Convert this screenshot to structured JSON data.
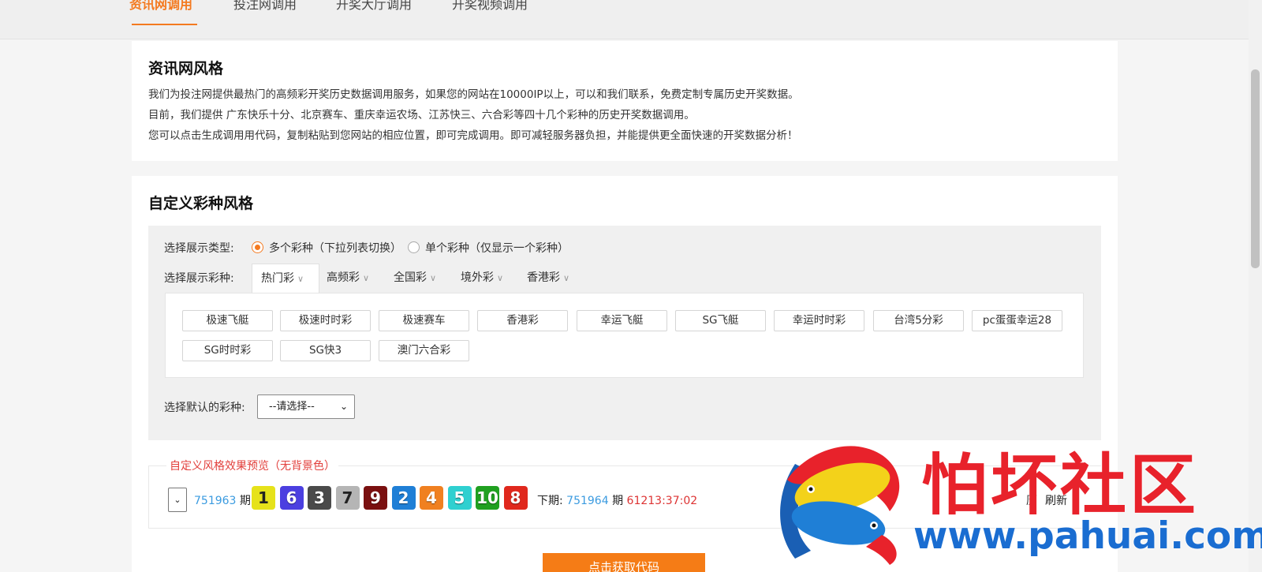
{
  "topnav": {
    "tabs": [
      {
        "label": "资讯网调用",
        "active": true
      },
      {
        "label": "投注网调用",
        "active": false
      },
      {
        "label": "开奖大厅调用",
        "active": false
      },
      {
        "label": "开奖视频调用",
        "active": false
      }
    ]
  },
  "intro": {
    "title": "资讯网风格",
    "lines": [
      "我们为投注网提供最热门的高频彩开奖历史数据调用服务，如果您的网站在10000IP以上，可以和我们联系，免费定制专属历史开奖数据。",
      "目前，我们提供 广东快乐十分、北京赛车、重庆幸运农场、江苏快三、六合彩等四十几个彩种的历史开奖数据调用。",
      "您可以点击生成调用用代码，复制粘贴到您网站的相应位置，即可完成调用。即可减轻服务器负担，并能提供更全面快速的开奖数据分析！"
    ]
  },
  "custom": {
    "title": "自定义彩种风格",
    "display_type_label": "选择展示类型:",
    "radio_multi": "多个彩种（下拉列表切换）",
    "radio_single": "单个彩种（仅显示一个彩种）",
    "display_lottery_label": "选择展示彩种:",
    "category_tabs": [
      "热门彩",
      "高频彩",
      "全国彩",
      "境外彩",
      "香港彩"
    ],
    "lotteries": [
      "极速飞艇",
      "极速时时彩",
      "极速赛车",
      "香港彩",
      "幸运飞艇",
      "SG飞艇",
      "幸运时时彩",
      "台湾5分彩",
      "pc蛋蛋幸运28",
      "SG时时彩",
      "SG快3",
      "澳门六合彩"
    ],
    "default_label": "选择默认的彩种:",
    "default_value": "--请选择--"
  },
  "preview": {
    "title": "自定义风格效果预览（无背景色）",
    "issue_no": "751963",
    "issue_unit": "期",
    "balls": [
      {
        "n": "1",
        "color": "#e6e21a"
      },
      {
        "n": "6",
        "color": "#4b3fe0"
      },
      {
        "n": "3",
        "color": "#4a4a4a"
      },
      {
        "n": "7",
        "color": "#b5b5b5"
      },
      {
        "n": "9",
        "color": "#7a1010"
      },
      {
        "n": "2",
        "color": "#1f7fd6"
      },
      {
        "n": "4",
        "color": "#f08020"
      },
      {
        "n": "5",
        "color": "#2fd0d0"
      },
      {
        "n": "10",
        "color": "#20a020"
      },
      {
        "n": "8",
        "color": "#e0281d"
      }
    ],
    "next_label": "下期:",
    "next_issue": "751964",
    "next_unit": "期",
    "countdown": "61213:37:02",
    "history_link": "历",
    "refresh_link": "刷新"
  },
  "get_code_button": "点击获取代码",
  "watermark": {
    "name": "怕坏社区",
    "url": "www.pahuai.com"
  }
}
